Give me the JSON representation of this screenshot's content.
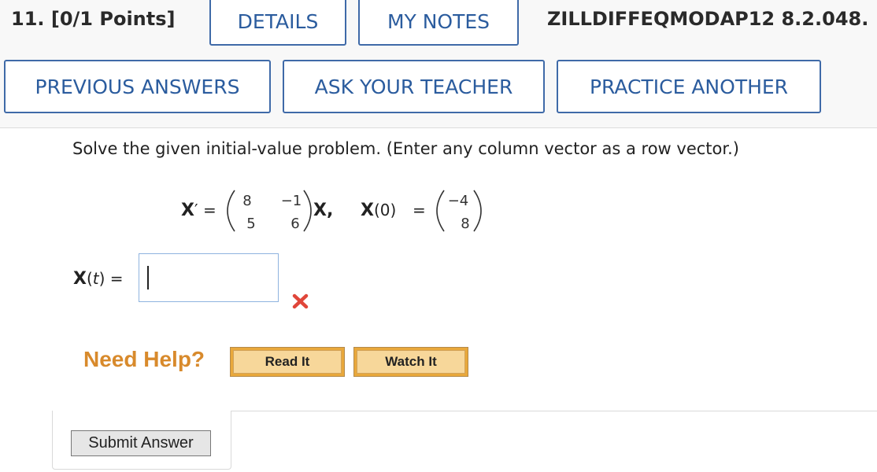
{
  "header": {
    "question_title": "11. [0/1 Points]",
    "details_label": "DETAILS",
    "my_notes_label": "MY NOTES",
    "assignment_code": "ZILLDIFFEQMODAP12 8.2.048.",
    "previous_answers_label": "PREVIOUS ANSWERS",
    "ask_teacher_label": "ASK YOUR TEACHER",
    "practice_another_label": "PRACTICE ANOTHER"
  },
  "question": {
    "prompt": "Solve the given initial-value problem. (Enter any column vector as a row vector.)",
    "equation": {
      "lhs": "X",
      "prime": "′",
      "equals": "=",
      "matrix": [
        [
          "8",
          "−1"
        ],
        [
          "5",
          "6"
        ]
      ],
      "after_matrix": "X,",
      "ic_var": "X",
      "ic_arg": "(0)",
      "ic_vector": [
        "−4",
        "8"
      ]
    },
    "answer": {
      "label_var": "X",
      "label_open": "(",
      "label_t": "t",
      "label_close": ")",
      "label_equals": " =",
      "value": "",
      "status": "incorrect"
    }
  },
  "help": {
    "label": "Need Help?",
    "read_it": "Read It",
    "watch_it": "Watch It"
  },
  "submit_label": "Submit Answer",
  "colors": {
    "pill_border": "#3f6aa8",
    "pill_text": "#2b5c9e",
    "need_help": "#d88a2c",
    "help_button": "#f7d79a",
    "wrong_mark": "#e0463a",
    "input_border": "#8fb3df"
  }
}
